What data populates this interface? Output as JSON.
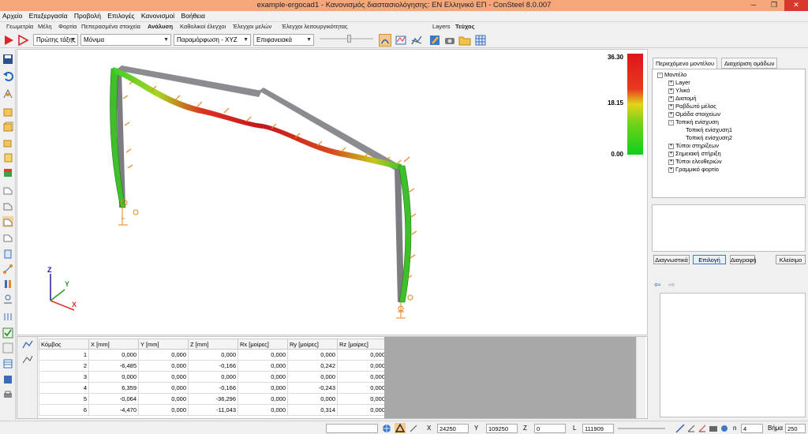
{
  "window": {
    "title": "example-ergocad1 - Κανονισμός διαστασιολόγησης: EN Ελληνικό ΕΠ - ConSteel 8.0.007",
    "minimize": "─",
    "maximize": "❐",
    "close": "✕",
    "titlebar_color": "#f6a77a"
  },
  "menu": [
    "Αρχείο",
    "Επεξεργασία",
    "Προβολή",
    "Επιλογές",
    "Κανονισμοί",
    "Βοήθεια"
  ],
  "tabs": [
    "Γεωμετρία",
    "Μέλη",
    "Φορτία",
    "Πεπερασμένα στοιχεία",
    "Ανάλυση",
    "Καθολικοί έλεγχοι",
    "Έλεγχοι μελών",
    "Έλεγχοι λειτουργικότητας",
    "Layers",
    "Τεύχος"
  ],
  "active_tabs": [
    "Ανάλυση",
    "Τεύχος"
  ],
  "toolbar": {
    "analysis_type": "Πρώτης τάξης",
    "load_case": "Μόνιμα",
    "result_type": "Παραμόρφωση - XYZ",
    "display_mode": "Επιφανειακά"
  },
  "legend": {
    "max": "36.30",
    "mid": "18.15",
    "min": "0.00"
  },
  "axes": {
    "z": "Z",
    "y": "Y",
    "x": "X"
  },
  "table": {
    "headers": [
      "Κόμβος",
      "X [mm]",
      "Y [mm]",
      "Z [mm]",
      "Rx [μοίρες]",
      "Ry [μοίρες]",
      "Rz [μοίρες]"
    ],
    "rows": [
      [
        "1",
        "0,000",
        "0,000",
        "0,000",
        "0,000",
        "0,000",
        "0,000"
      ],
      [
        "2",
        "-6,485",
        "0,000",
        "-0,166",
        "0,000",
        "0,242",
        "0,000"
      ],
      [
        "3",
        "0,000",
        "0,000",
        "0,000",
        "0,000",
        "0,000",
        "0,000"
      ],
      [
        "4",
        "6,359",
        "0,000",
        "-0,166",
        "0,000",
        "-0,243",
        "0,000"
      ],
      [
        "5",
        "-0,064",
        "0,000",
        "-36,296",
        "0,000",
        "0,000",
        "0,000"
      ],
      [
        "6",
        "-4,470",
        "0,000",
        "-11,043",
        "0,000",
        "0,314",
        "0,000"
      ]
    ]
  },
  "right_panel": {
    "tab_content": "Περιεχόμενο μοντέλου",
    "tab_groups": "Διαχείριση ομάδων",
    "tree": {
      "root": "Μοντέλο",
      "items": [
        "Layer",
        "Υλικό",
        "Διατομή",
        "Ραβδωτό μέλος",
        "Ομάδα στοιχείων",
        "Τοπική ενίσχυση"
      ],
      "children": [
        "Τοπική ενίσχυση1",
        "Τοπική ενίσχυση2"
      ],
      "items2": [
        "Τύποι στηρίξεων",
        "Σημειακή στήριξη",
        "Τύποι ελευθεριών",
        "Γραμμικό φορτίο"
      ]
    },
    "buttons": [
      "Διαγνωστικά",
      "Επιλογή",
      "Διαγραφή",
      "Κλείσιμο"
    ],
    "nav_back": "⇦",
    "nav_fwd": "⇨"
  },
  "status": {
    "x_label": "X",
    "x": "24250",
    "y_label": "Y",
    "y": "109250",
    "z_label": "Z",
    "z": "0",
    "l_label": "L",
    "l": "111909",
    "n_label": "n",
    "n": "4",
    "step_label": "Βήμα",
    "step": "250"
  }
}
